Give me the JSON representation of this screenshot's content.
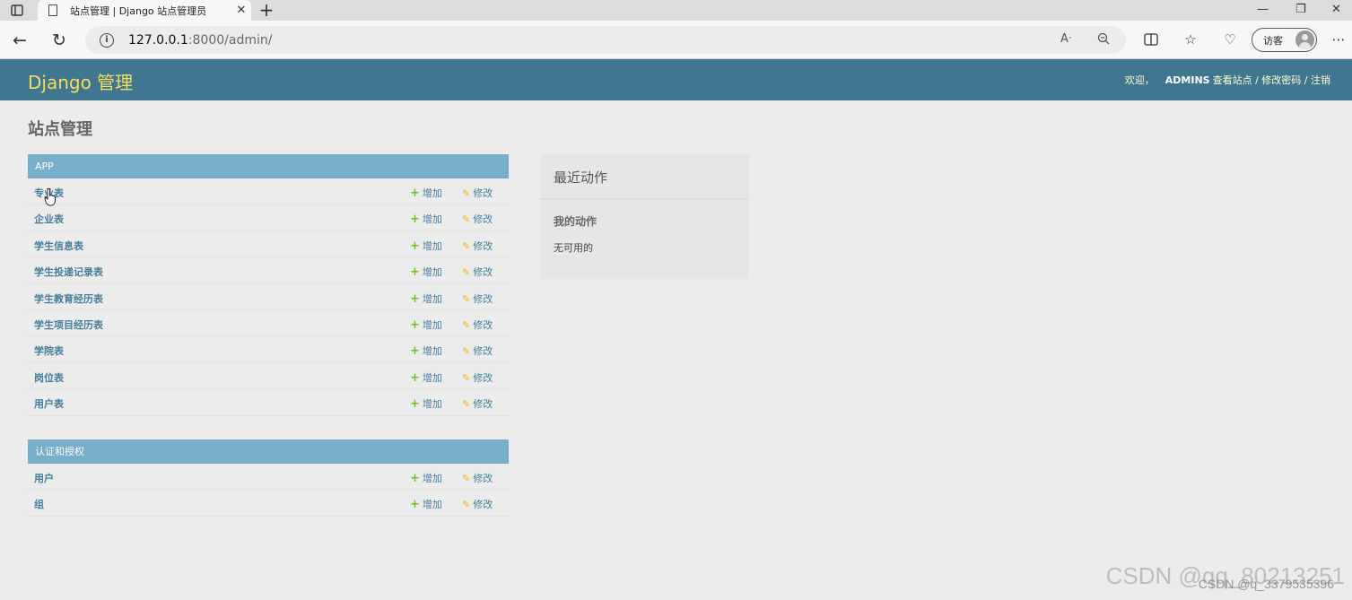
{
  "browser": {
    "tab_title": "站点管理 | Django 站点管理员",
    "url_host": "127.0.0.1",
    "url_path": ":8000/admin/",
    "profile_label": "访客"
  },
  "header": {
    "branding": "Django 管理",
    "welcome": "欢迎，",
    "username": "ADMINS",
    "links": "查看站点 / 修改密码 / 注销"
  },
  "page_title": "站点管理",
  "modules": [
    {
      "caption": "APP",
      "models": [
        {
          "name": "专业表",
          "add": "增加",
          "change": "修改"
        },
        {
          "name": "企业表",
          "add": "增加",
          "change": "修改"
        },
        {
          "name": "学生信息表",
          "add": "增加",
          "change": "修改"
        },
        {
          "name": "学生投递记录表",
          "add": "增加",
          "change": "修改"
        },
        {
          "name": "学生教育经历表",
          "add": "增加",
          "change": "修改"
        },
        {
          "name": "学生项目经历表",
          "add": "增加",
          "change": "修改"
        },
        {
          "name": "学院表",
          "add": "增加",
          "change": "修改"
        },
        {
          "name": "岗位表",
          "add": "增加",
          "change": "修改"
        },
        {
          "name": "用户表",
          "add": "增加",
          "change": "修改"
        }
      ]
    },
    {
      "caption": "认证和授权",
      "models": [
        {
          "name": "用户",
          "add": "增加",
          "change": "修改"
        },
        {
          "name": "组",
          "add": "增加",
          "change": "修改"
        }
      ]
    }
  ],
  "recent_actions": {
    "title": "最近动作",
    "my_actions": "我的动作",
    "none": "无可用的"
  },
  "watermark": {
    "main": "CSDN @qq_80213251",
    "secondary": "CSDN @q_3379535396"
  },
  "colors": {
    "header_bg": "#417690",
    "branding": "#f5dd5d",
    "caption_bg": "#79aec8",
    "link": "#447e9b",
    "add_icon": "#70bf2b",
    "change_icon": "#efb80b"
  }
}
